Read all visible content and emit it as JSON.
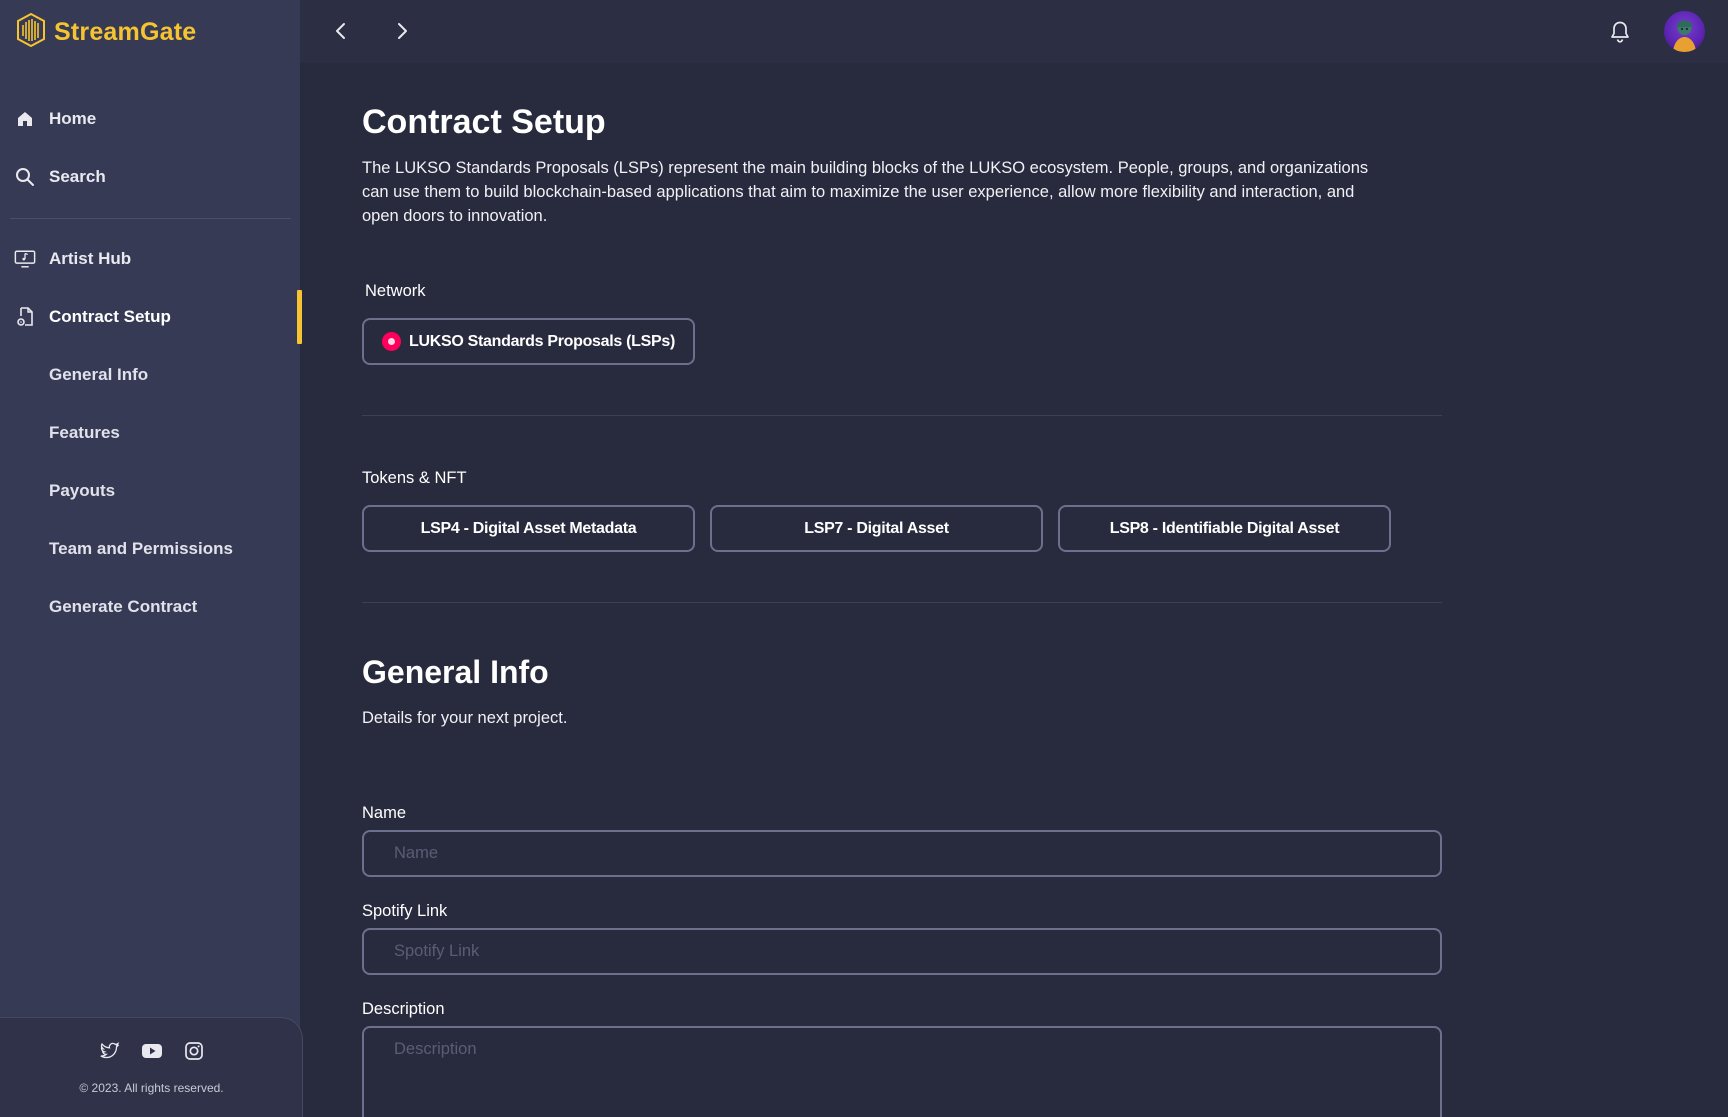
{
  "brand": {
    "name": "StreamGate",
    "accent": "#f6c430"
  },
  "sidebar": {
    "items": [
      {
        "label": "Home",
        "icon": "home-icon"
      },
      {
        "label": "Search",
        "icon": "search-icon"
      },
      {
        "label": "Artist Hub",
        "icon": "monitor-music-icon"
      },
      {
        "label": "Contract Setup",
        "icon": "document-gear-icon",
        "active": true
      },
      {
        "label": "General Info"
      },
      {
        "label": "Features"
      },
      {
        "label": "Payouts"
      },
      {
        "label": "Team and Permissions"
      },
      {
        "label": "Generate Contract"
      }
    ],
    "social": [
      "twitter-icon",
      "youtube-icon",
      "instagram-icon"
    ],
    "copyright": "© 2023. All rights reserved."
  },
  "topbar": {
    "back_icon": "chevron-left-icon",
    "forward_icon": "chevron-right-icon",
    "notification_icon": "bell-icon"
  },
  "contract_setup": {
    "title": "Contract Setup",
    "description": "The LUKSO Standards Proposals (LSPs) represent the main building blocks of the LUKSO ecosystem. People, groups, and organizations can use them to build blockchain-based applications that aim to maximize the user experience, allow more flexibility and interaction, and open doors to innovation.",
    "network_label": "Network",
    "network_option": "LUKSO Standards Proposals (LSPs)",
    "network_color": "#fe005b",
    "tokens_label": "Tokens & NFT",
    "tokens": [
      "LSP4 - Digital Asset Metadata",
      "LSP7 - Digital Asset",
      "LSP8 - Identifiable Digital Asset"
    ]
  },
  "general_info": {
    "title": "General Info",
    "subtitle": "Details for your next project.",
    "name": {
      "label": "Name",
      "placeholder": "Name",
      "value": ""
    },
    "spotify": {
      "label": "Spotify Link",
      "placeholder": "Spotify Link",
      "value": ""
    },
    "description": {
      "label": "Description",
      "placeholder": "Description",
      "value": ""
    }
  }
}
